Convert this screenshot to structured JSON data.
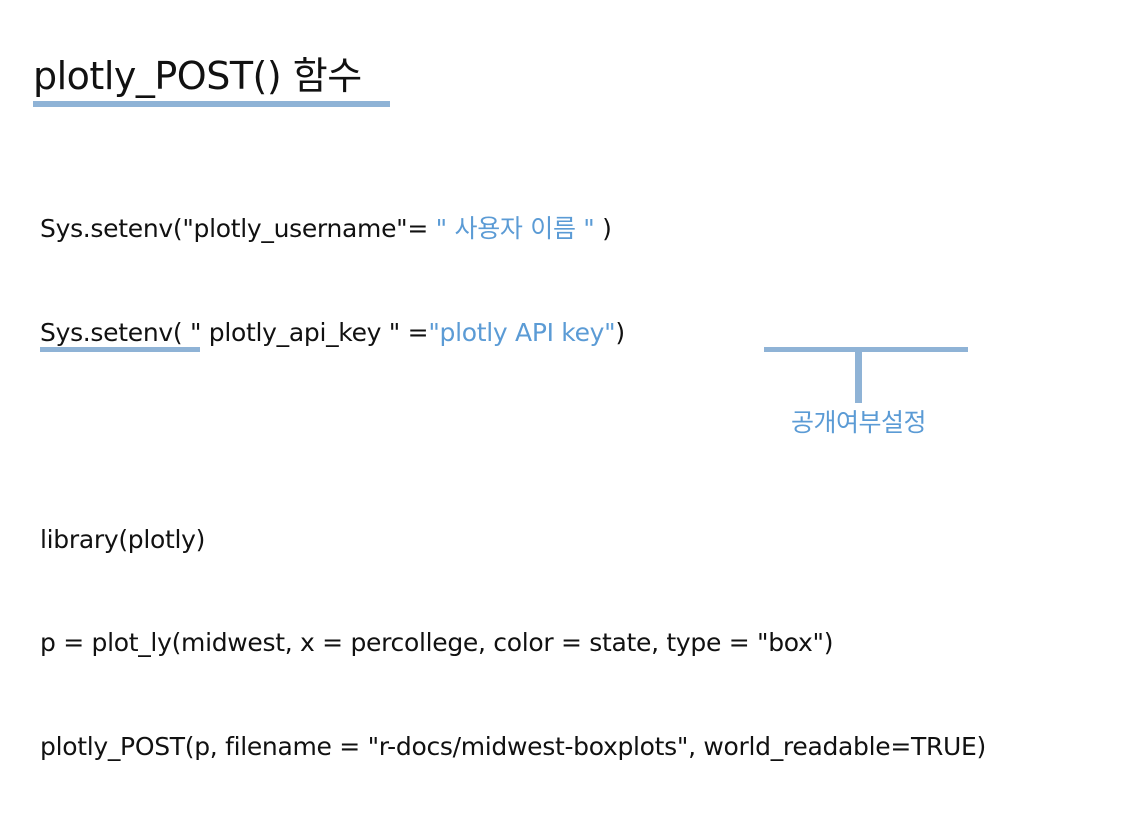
{
  "slide": {
    "title": "plotly_POST() 함수",
    "annotation": "공개여부설정",
    "accent_color": "#5b9bd5",
    "underline_color": "#8fb3d6",
    "text_color": "#111111"
  },
  "code": {
    "line1": {
      "pre": "Sys.setenv(\"plotly_username\"= ",
      "value": "\" 사용자 이름 \"",
      "post": " )"
    },
    "line2": {
      "pre": "Sys.setenv( \" plotly_api_key \" =",
      "value": "\"plotly API key\"",
      "post": ")"
    },
    "line3": "library(plotly)",
    "line4": "p = plot_ly(midwest, x = percollege, color = state, type = \"box\")",
    "line5": "plotly_POST(p, filename = \"r-docs/midwest-boxplots\", world_readable=TRUE)"
  }
}
